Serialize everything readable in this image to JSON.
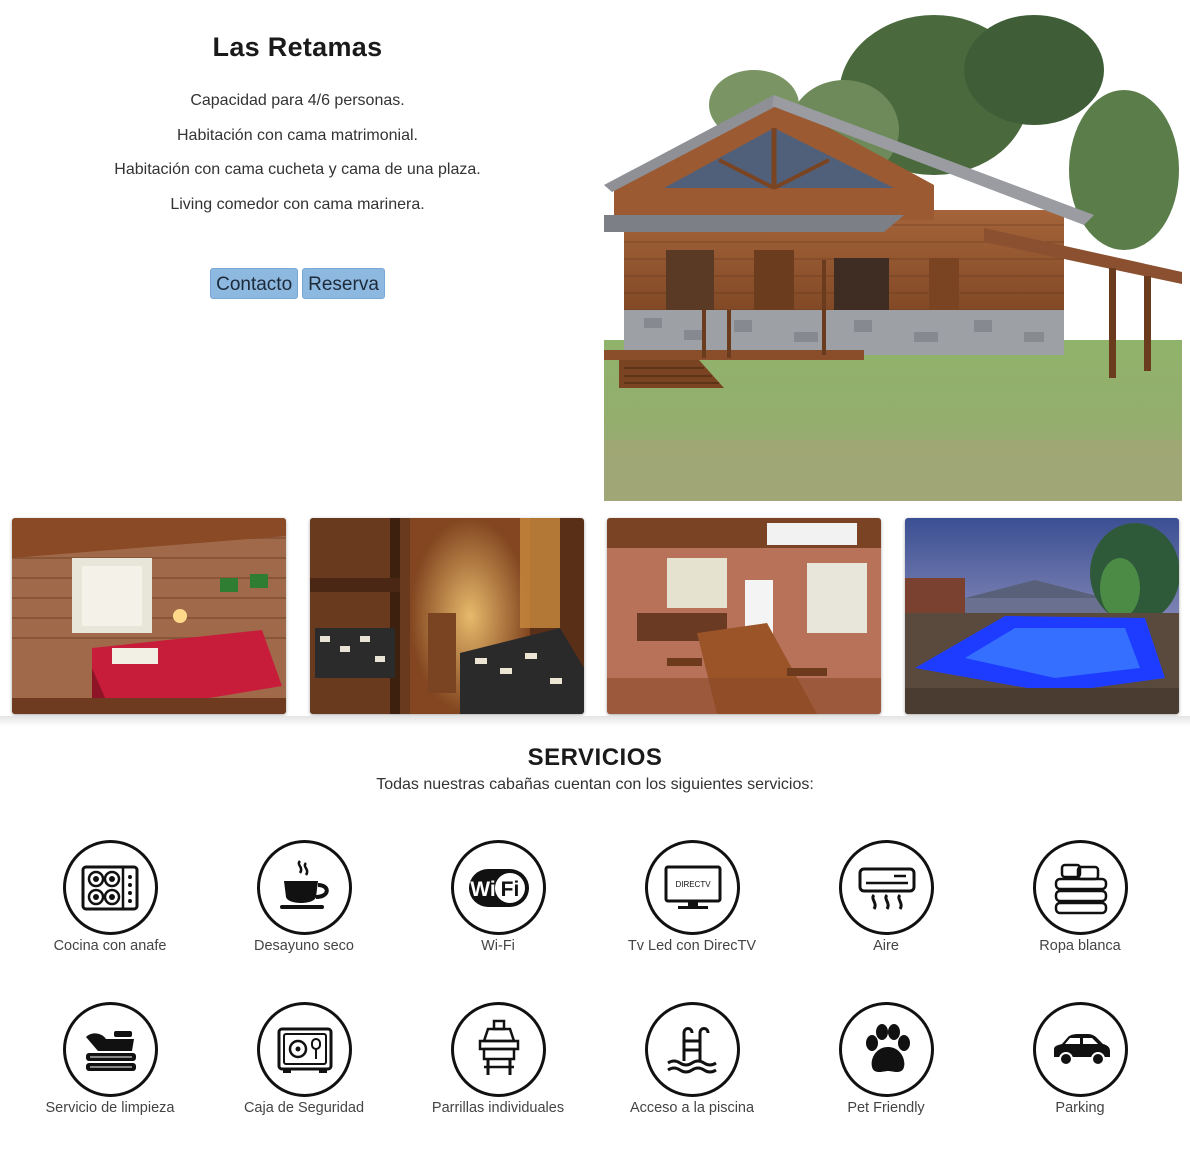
{
  "listing": {
    "title": "Las Retamas",
    "features": [
      "Capacidad para 4/6 personas.",
      "Habitación con cama matrimonial.",
      "Habitación con cama cucheta y cama de una plaza.",
      "Living comedor con cama marinera."
    ],
    "buttons": {
      "contact": "Contacto",
      "reserve": "Reserva"
    }
  },
  "services": {
    "title": "SERVICIOS",
    "subtitle": "Todas nuestras cabañas cuentan con los siguientes servicios:",
    "items": [
      {
        "label": "Cocina con anafe",
        "icon": "stove-icon"
      },
      {
        "label": "Desayuno seco",
        "icon": "coffee-cup-icon"
      },
      {
        "label": "Wi-Fi",
        "icon": "wifi-icon",
        "icon_text": [
          "Wi",
          "Fi"
        ]
      },
      {
        "label": "Tv Led con DirecTV",
        "icon": "tv-icon",
        "icon_text": "DIRECTV"
      },
      {
        "label": "Aire",
        "icon": "air-conditioner-icon"
      },
      {
        "label": "Ropa blanca",
        "icon": "linens-icon"
      },
      {
        "label": "Servicio de limpieza",
        "icon": "cleaning-icon"
      },
      {
        "label": "Caja de Seguridad",
        "icon": "safe-icon"
      },
      {
        "label": "Parrillas individuales",
        "icon": "grill-icon"
      },
      {
        "label": "Acceso a la piscina",
        "icon": "pool-ladder-icon"
      },
      {
        "label": "Pet Friendly",
        "icon": "paw-icon"
      },
      {
        "label": "Parking",
        "icon": "car-icon"
      }
    ]
  },
  "colors": {
    "button_bg": "#8db8e0",
    "pool_blue": "#1e3cff"
  }
}
